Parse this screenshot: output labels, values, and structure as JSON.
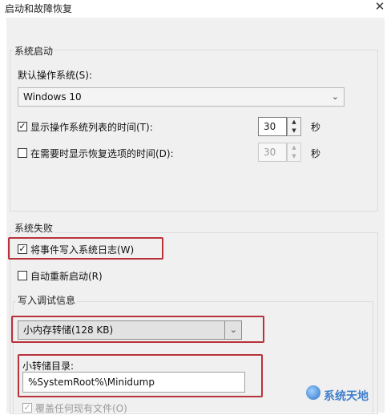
{
  "window": {
    "title": "启动和故障恢复",
    "close_glyph": "✕"
  },
  "system_startup": {
    "group_label": "系统启动",
    "default_os_label": "默认操作系统(S):",
    "default_os_value": "Windows 10",
    "show_os_list": {
      "checked": true,
      "label": "显示操作系统列表的时间(T):",
      "value": "30",
      "unit": "秒"
    },
    "show_recovery": {
      "checked": false,
      "label": "在需要时显示恢复选项的时间(D):",
      "value": "30",
      "unit": "秒"
    }
  },
  "system_failure": {
    "group_label": "系统失败",
    "write_event_log": {
      "checked": true,
      "label": "将事件写入系统日志(W)"
    },
    "auto_restart": {
      "checked": false,
      "label": "自动重新启动(R)"
    },
    "debug_info": {
      "group_label": "写入调试信息",
      "dump_type": "小内存转储(128 KB)",
      "dump_dir_label": "小转储目录:",
      "dump_dir_value": "%SystemRoot%\\Minidump",
      "overwrite": {
        "checked": true,
        "label": "覆盖任何现有文件(O)"
      }
    }
  },
  "watermark": {
    "text": "系统天地"
  },
  "icons": {
    "check": "☑",
    "checkmark_glyph": "✓",
    "dropdown": "chevron-down-icon",
    "spin_up": "▲",
    "spin_down": "▼",
    "arrow": "⌄"
  }
}
